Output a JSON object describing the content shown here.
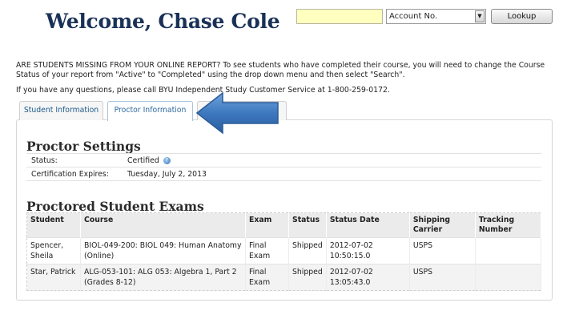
{
  "header": {
    "welcome": "Welcome, Chase Cole",
    "search_type": "Account No.",
    "lookup_label": "Lookup"
  },
  "message": {
    "missing": "ARE STUDENTS MISSING FROM YOUR ONLINE REPORT? To see students who have completed their course, you will need to change the Course Status of your report from \"Active\" to \"Completed\" using the drop down menu and then select \"Search\".",
    "help": "If you have any questions, please call BYU Independent Study Customer Service at 1-800-259-0172."
  },
  "tabs": [
    {
      "label": "Student Information"
    },
    {
      "label": "Proctor Information"
    },
    {
      "label": ""
    }
  ],
  "proctor_settings": {
    "title": "Proctor Settings",
    "rows": [
      {
        "key": "Status:",
        "value": "Certified"
      },
      {
        "key": "Certification Expires:",
        "value": "Tuesday, July 2, 2013"
      }
    ]
  },
  "exams": {
    "title": "Proctored Student Exams",
    "columns": [
      "Student",
      "Course",
      "Exam",
      "Status",
      "Status Date",
      "Shipping Carrier",
      "Tracking Number"
    ],
    "rows": [
      {
        "student": "Spencer, Sheila",
        "course": "BIOL-049-200: BIOL 049: Human Anatomy (Online)",
        "exam": "Final Exam",
        "status": "Shipped",
        "date": "2012-07-02 10:50:15.0",
        "carrier": "USPS",
        "tracking": ""
      },
      {
        "student": "Star, Patrick",
        "course": "ALG-053-101: ALG 053: Algebra 1, Part 2 (Grades 8-12)",
        "exam": "Final Exam",
        "status": "Shipped",
        "date": "2012-07-02 13:05:43.0",
        "carrier": "USPS",
        "tracking": ""
      }
    ]
  },
  "icons": {
    "help": "question-icon",
    "pointer": "arrow-pointer-icon",
    "dropdown": "chevron-down-icon"
  },
  "colors": {
    "title": "#1a3157",
    "arrow": "#3d78bf",
    "input_bg": "#ffffc0"
  }
}
